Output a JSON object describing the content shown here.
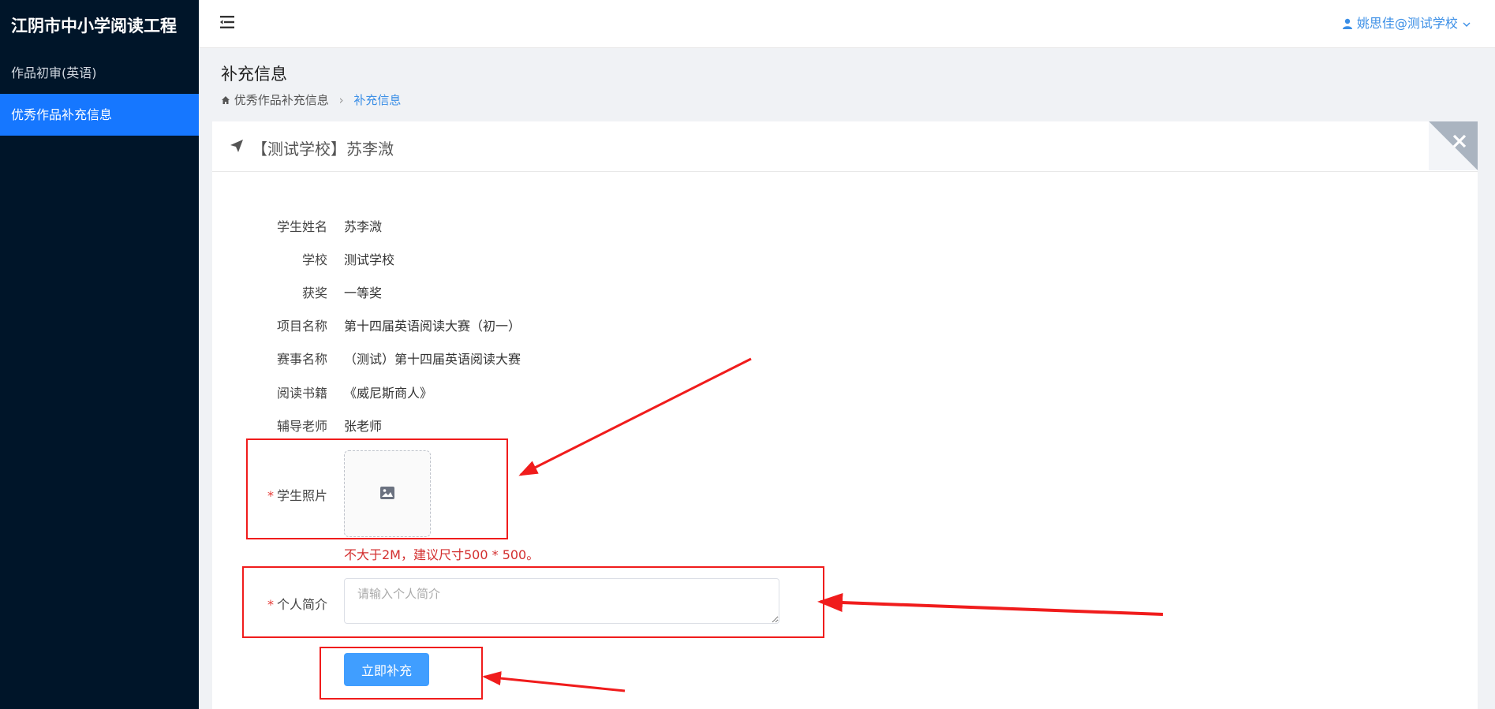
{
  "app": {
    "title": "江阴市中小学阅读工程"
  },
  "sidebar": {
    "items": [
      {
        "label": "作品初审(英语)",
        "active": false
      },
      {
        "label": "优秀作品补充信息",
        "active": true
      }
    ]
  },
  "header": {
    "user": "姚思佳@测试学校"
  },
  "page": {
    "title": "补充信息",
    "breadcrumb": {
      "home": "优秀作品补充信息",
      "current": "补充信息"
    }
  },
  "card": {
    "title": "【测试学校】苏李溦"
  },
  "fields": [
    {
      "label": "学生姓名",
      "value": "苏李溦"
    },
    {
      "label": "学校",
      "value": "测试学校"
    },
    {
      "label": "获奖",
      "value": "一等奖"
    },
    {
      "label": "项目名称",
      "value": "第十四届英语阅读大赛（初一）"
    },
    {
      "label": "赛事名称",
      "value": "（测试）第十四届英语阅读大赛"
    },
    {
      "label": "阅读书籍",
      "value": "《威尼斯商人》"
    },
    {
      "label": "辅导老师",
      "value": "张老师"
    }
  ],
  "photo": {
    "required_mark": "*",
    "label": "学生照片",
    "hint": "不大于2M，建议尺寸500 * 500。"
  },
  "intro": {
    "required_mark": "*",
    "label": "个人简介",
    "value": "",
    "placeholder": "请输入个人简介"
  },
  "submit": {
    "label": "立即补充"
  },
  "colors": {
    "sidebar_bg": "#001529",
    "active_item": "#1677ff",
    "primary": "#409eff",
    "annotation": "#f01c1c"
  }
}
